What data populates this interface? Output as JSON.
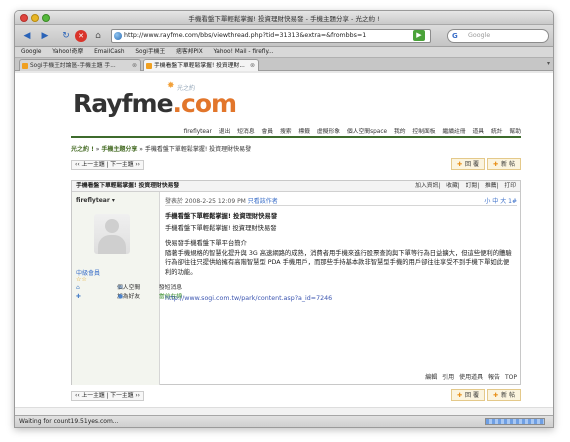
{
  "window": {
    "title": "手機看盤下單輕鬆掌握! 投資理財快易發 - 手機主題分享 - 光之約 !"
  },
  "toolbar": {
    "url": "http://www.rayfme.com/bbs/viewthread.php?tid=31313&extra=&frombbs=1",
    "search_placeholder": "Google",
    "search_engine_icon": "G"
  },
  "bookmarks": [
    "Google",
    "Yahoo!奇摩",
    "EmailCash",
    "Sogi手機王",
    "痞客邦PIX",
    "Yahoo! Mail - firefly..."
  ],
  "tabs": [
    {
      "label": "Sogi手機王討論區-手機主題 手..."
    },
    {
      "label": "手機看盤下單輕鬆掌握! 投資理財..."
    }
  ],
  "site": {
    "logo_main": "Rayfme",
    "logo_ext": ".com",
    "logo_cn": "光之約"
  },
  "nav": {
    "items": [
      "fireflytear",
      "退出",
      "短消息",
      "會員",
      "搜索",
      "標籤",
      "虛擬形象",
      "個人空間space",
      "我的",
      "控制面板",
      "繼續註冊",
      "道具",
      "統計",
      "幫助"
    ]
  },
  "breadcrumb": {
    "home": "光之約 !",
    "sep": "»",
    "forum": "手機主題分享",
    "current": "» 手機看盤下單輕鬆掌握! 投資理財快易發"
  },
  "pager": {
    "label": "‹‹ 上一主題 | 下一主題 ››"
  },
  "buttons": {
    "reply": "回 覆",
    "new_post": "新 帖"
  },
  "thread": {
    "title": "手機看盤下單輕鬆掌握! 投資理財快易發",
    "tools": [
      "加入資訊",
      "收藏",
      "訂閱",
      "推薦",
      "打印"
    ]
  },
  "author": {
    "name": "fireflytear",
    "rank": "中級會員",
    "stars": "☆☆",
    "links": [
      {
        "label": "個人空間",
        "label2": "發短消息"
      },
      {
        "label": "加為好友",
        "label2": "當前在線"
      }
    ]
  },
  "post": {
    "meta_prefix": "發表於 2008-2-25 12:09 PM",
    "meta_only": "只看該作者",
    "size": "小 中 大",
    "floor": "1#",
    "title": "手機看盤下單輕鬆掌握! 投資理財快易發",
    "subtitle": "手機看盤下單輕鬆掌握! 投資理財快易發",
    "intro": "快易發手機看盤下單平台簡介",
    "body": "隨著手機規格的智慧化提升與 3G 高速網路的成熟，消費者用手機來進行股票查詢與下單等行為日益擴大，但這些便利的體驗行為卻往往只提供給擁有高階智慧型 PDA 手機用戶，而那些手持基本款非智慧型手機的用戶卻往往享受不到手機下單如此便利的功能。",
    "link": "http://www.sogi.com.tw/park/content.asp?a_id=7246",
    "actions": [
      "編輯",
      "引用",
      "使用道具",
      "報告",
      "TOP"
    ]
  },
  "status": {
    "text": "Waiting for count19.51yes.com..."
  }
}
